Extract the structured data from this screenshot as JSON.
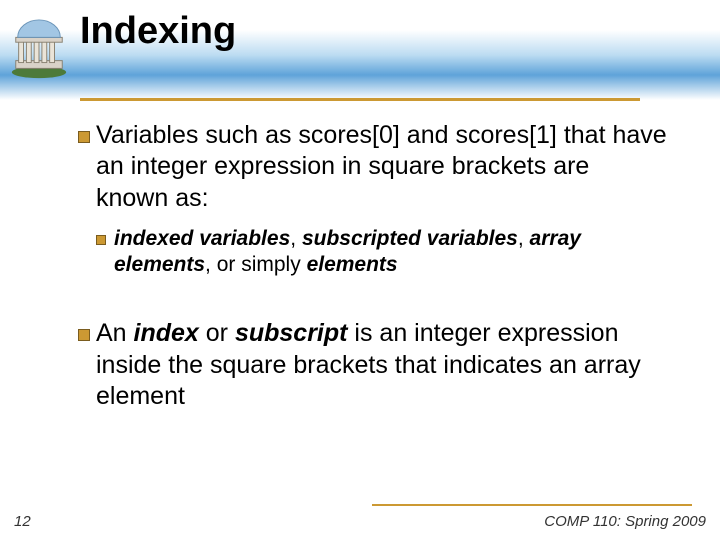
{
  "header": {
    "title": "Indexing",
    "logo_name": "rotunda-logo"
  },
  "bullets": {
    "b1": {
      "t1": "Variables such as scores[0] and scores[1] that have an integer expression in square brackets are known as:"
    },
    "sub1": {
      "s1": "indexed variables",
      "comma1": ", ",
      "s2": "subscripted variables",
      "comma2": ", ",
      "s3": "array elements",
      "comma3": ", or simply ",
      "s4": "elements"
    },
    "b2": {
      "pre": "An ",
      "k1": "index",
      "mid": " or ",
      "k2": "subscript",
      "post": " is an integer expression inside the square brackets that indicates an array element"
    }
  },
  "footer": {
    "page": "12",
    "course": "COMP 110: Spring 2009"
  }
}
